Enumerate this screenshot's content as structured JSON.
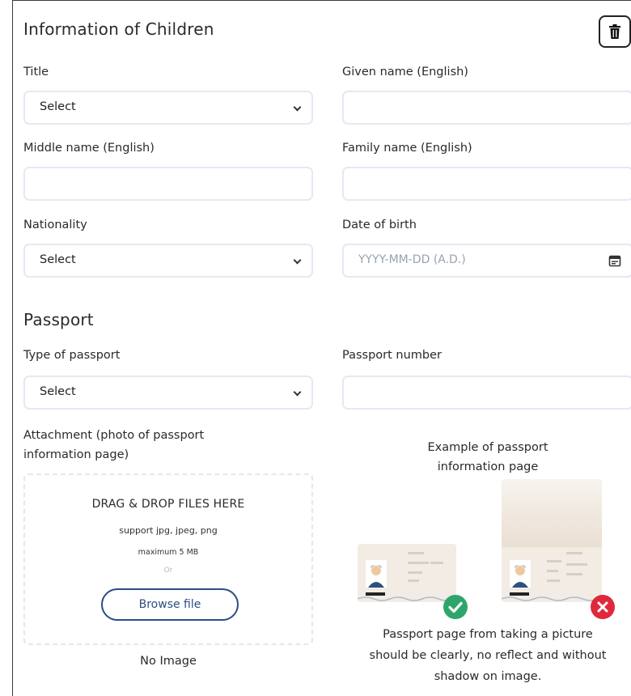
{
  "section": {
    "title": "Information of Children",
    "delete_icon": "trash-icon"
  },
  "fields": {
    "title": {
      "label": "Title",
      "value": "Select"
    },
    "given_name": {
      "label": "Given name (English)",
      "value": ""
    },
    "middle_name": {
      "label": "Middle name (English)",
      "value": ""
    },
    "family_name": {
      "label": "Family name (English)",
      "value": ""
    },
    "nationality": {
      "label": "Nationality",
      "value": "Select"
    },
    "dob": {
      "label": "Date of birth",
      "placeholder": "YYYY-MM-DD (A.D.)",
      "icon": "calendar-icon"
    }
  },
  "passport": {
    "title": "Passport",
    "type": {
      "label": "Type of passport",
      "value": "Select"
    },
    "number": {
      "label": "Passport number",
      "value": ""
    },
    "attachment": {
      "label_line1": "Attachment (photo of passport",
      "label_line2": "information page)",
      "drop_title": "DRAG & DROP FILES HERE",
      "support": "support jpg, jpeg, png",
      "max_size": "maximum 5 MB",
      "or": "Or",
      "browse": "Browse file",
      "status": "No Image"
    },
    "example": {
      "title_line1": "Example of passport",
      "title_line2": "information page",
      "note_line1": "Passport page from taking a picture",
      "note_line2": "should be clearly, no reflect and without",
      "note_line3": "shadow on image.",
      "good_icon": "check-icon",
      "bad_icon": "cross-icon"
    }
  },
  "colors": {
    "field_border": "#e4e9f2",
    "accent": "#2d4c83",
    "success": "#2ea66b",
    "error": "#e0283c"
  }
}
